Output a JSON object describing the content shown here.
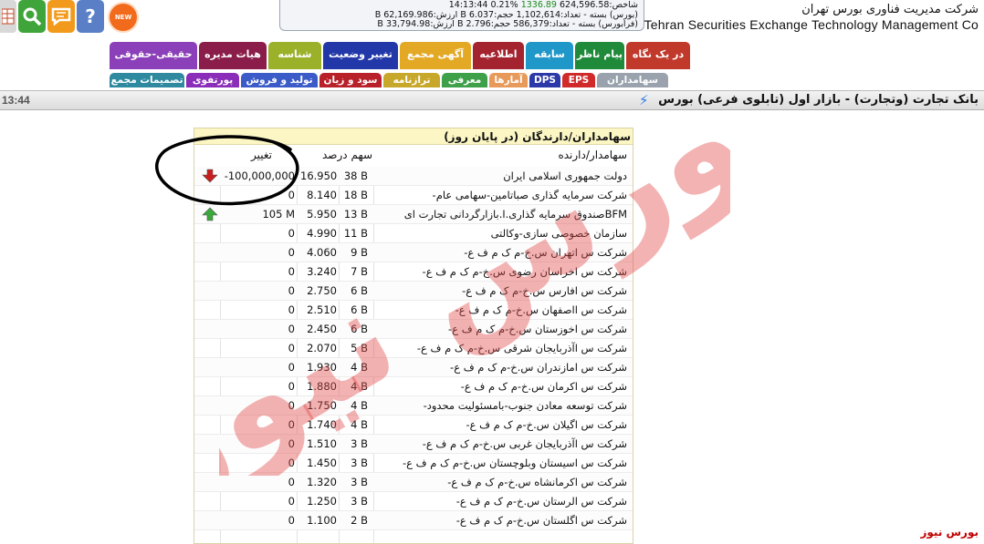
{
  "header": {
    "company_fa": "شرکت مدیریت فناوری بورس تهران",
    "company_en": "Tehran Securities Exchange Technology Management  Co",
    "index_line": {
      "prefix": "شاخص:",
      "value": "624,596.58",
      "change": "1336.89",
      "percent": "%0.21",
      "time": "14:13:44"
    },
    "bourse_line": "(بورس) بسته - تعداد:1,102,614 حجم:6.037 B ارزش:62,169.986 B",
    "farabourse_line": "(فرابورس) بسته - تعداد:586,379 حجم:2.796 B ارزش:33,794.98 B",
    "new_badge": "NEW"
  },
  "tabs_row1": [
    {
      "label": "در یک نگاه",
      "color": "#c0392b"
    },
    {
      "label": "پیام ناظر",
      "color": "#1f8a3a"
    },
    {
      "label": "سابقه",
      "color": "#1f97c9"
    },
    {
      "label": "اطلاعیه",
      "color": "#a3232f"
    },
    {
      "label": "آگهی مجمع",
      "color": "#e3a925"
    },
    {
      "label": "تغییر وضعیت",
      "color": "#2338a8"
    },
    {
      "label": "شناسه",
      "color": "#9bb12a"
    },
    {
      "label": "هیات مدیره",
      "color": "#8a1d4a"
    },
    {
      "label": "حقیقی-حقوقی",
      "color": "#8b3fb8"
    }
  ],
  "tabs_row2": [
    {
      "label": "سهامداران",
      "color": "#9aa3ad"
    },
    {
      "label": "EPS",
      "color": "#d02a2a"
    },
    {
      "label": "DPS",
      "color": "#2b3aa8"
    },
    {
      "label": "آمارها",
      "color": "#e89a5a"
    },
    {
      "label": "معرفی",
      "color": "#3fa04a"
    },
    {
      "label": "ترازنامه",
      "color": "#c8a82a"
    },
    {
      "label": "سود و زیان",
      "color": "#b8202a"
    },
    {
      "label": "تولید و فروش",
      "color": "#3b5cc8"
    },
    {
      "label": "پورتفوی",
      "color": "#8a2db8"
    },
    {
      "label": "تصمیمات مجمع",
      "color": "#2f8aa0"
    }
  ],
  "titlebar": {
    "title": "بانک تجارت (وتجارت) - بازار اول (تابلوی فرعی) بورس",
    "time": "13:44"
  },
  "panel": {
    "title": "سهامداران/دارندگان (در پایان روز)",
    "col_holder": "سهامدار/دارنده",
    "col_share": "سهم",
    "col_percent": "درصد",
    "col_change": "تغییر"
  },
  "rows": [
    {
      "holder": "دولت جمهوری اسلامی ایران",
      "shares": "38 B",
      "percent": "16.950",
      "change": "-100,000,000",
      "arrow": "down"
    },
    {
      "holder": "شرکت سرمایه گذاری صباتامین-سهامی عام-",
      "shares": "18 B",
      "percent": "8.140",
      "change": "0",
      "arrow": ""
    },
    {
      "holder": "BFMصندوق سرمایه گذاری.ا.بازارگردانی تجارت ای",
      "shares": "13 B",
      "percent": "5.950",
      "change": "105 M",
      "arrow": "up"
    },
    {
      "holder": "سازمان خصوصی سازی-وکالتی",
      "shares": "11 B",
      "percent": "4.990",
      "change": "0",
      "arrow": ""
    },
    {
      "holder": "شرکت س اتهران س.خ-م ک م ف ع-",
      "shares": "9 B",
      "percent": "4.060",
      "change": "0",
      "arrow": ""
    },
    {
      "holder": "شرکت س اخراسان رضوی س.خ-م ک م ف ع-",
      "shares": "7 B",
      "percent": "3.240",
      "change": "0",
      "arrow": ""
    },
    {
      "holder": "شرکت س افارس س.خ-م ک م ف ع-",
      "shares": "6 B",
      "percent": "2.750",
      "change": "0",
      "arrow": ""
    },
    {
      "holder": "شرکت س ااصفهان س.خ-م ک م ف ع-",
      "shares": "6 B",
      "percent": "2.510",
      "change": "0",
      "arrow": ""
    },
    {
      "holder": "شرکت س اخوزستان س.خ-م ک م ف ع-",
      "shares": "6 B",
      "percent": "2.450",
      "change": "0",
      "arrow": ""
    },
    {
      "holder": "شرکت س اآذربایجان شرقی س.خ-م ک م ف ع-",
      "shares": "5 B",
      "percent": "2.070",
      "change": "0",
      "arrow": ""
    },
    {
      "holder": "شرکت س امازندران س.خ-م ک م ف ع-",
      "shares": "4 B",
      "percent": "1.930",
      "change": "0",
      "arrow": ""
    },
    {
      "holder": "شرکت س اکرمان س.خ-م ک م ف ع-",
      "shares": "4 B",
      "percent": "1.880",
      "change": "0",
      "arrow": ""
    },
    {
      "holder": "شرکت توسعه معادن جنوب-بامسئولیت محدود-",
      "shares": "4 B",
      "percent": "1.750",
      "change": "0",
      "arrow": ""
    },
    {
      "holder": "شرکت س اگیلان س.خ-م ک م ف ع-",
      "shares": "4 B",
      "percent": "1.740",
      "change": "0",
      "arrow": ""
    },
    {
      "holder": "شرکت س اآذربایجان غربی س.خ-م ک م ف ع-",
      "shares": "3 B",
      "percent": "1.510",
      "change": "0",
      "arrow": ""
    },
    {
      "holder": "شرکت س اسیستان وبلوچستان س.خ-م ک م ف ع-",
      "shares": "3 B",
      "percent": "1.450",
      "change": "0",
      "arrow": ""
    },
    {
      "holder": "شرکت س اکرمانشاه س.خ-م ک م ف ع-",
      "shares": "3 B",
      "percent": "1.320",
      "change": "0",
      "arrow": ""
    },
    {
      "holder": "شرکت س الرستان س.خ-م ک م ف ع-",
      "shares": "3 B",
      "percent": "1.250",
      "change": "0",
      "arrow": ""
    },
    {
      "holder": "شرکت س اگلستان س.خ-م ک م ف ع-",
      "shares": "2 B",
      "percent": "1.100",
      "change": "0",
      "arrow": ""
    }
  ],
  "watermark": {
    "text": "بورس نیوز",
    "color": "#e34b4b"
  },
  "brand": "بورس نیوز"
}
